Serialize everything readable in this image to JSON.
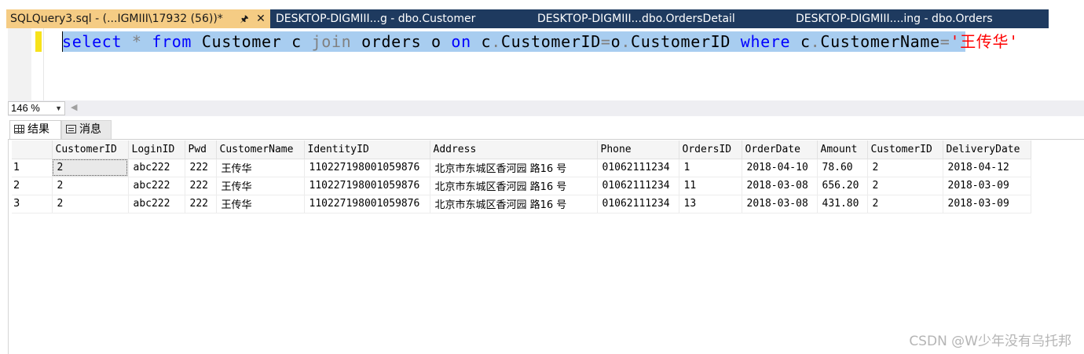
{
  "tabs": [
    {
      "label": "SQLQuery3.sql - (...IGMIII\\17932 (56))*",
      "active": true
    },
    {
      "label": "DESKTOP-DIGMIII...g - dbo.Customer",
      "active": false
    },
    {
      "label": "DESKTOP-DIGMIII...dbo.OrdersDetail",
      "active": false
    },
    {
      "label": "DESKTOP-DIGMIII....ing - dbo.Orders",
      "active": false
    }
  ],
  "tab_icons": {
    "pin": "pin-icon",
    "close": "close-icon"
  },
  "editor": {
    "tokens": [
      {
        "text": "select",
        "kind": "keyword"
      },
      {
        "text": " ",
        "kind": "plain"
      },
      {
        "text": "*",
        "kind": "operator"
      },
      {
        "text": " ",
        "kind": "plain"
      },
      {
        "text": "from",
        "kind": "keyword"
      },
      {
        "text": " Customer c ",
        "kind": "plain"
      },
      {
        "text": "join",
        "kind": "operator"
      },
      {
        "text": " orders o ",
        "kind": "plain"
      },
      {
        "text": "on",
        "kind": "keyword"
      },
      {
        "text": " c",
        "kind": "plain"
      },
      {
        "text": ".",
        "kind": "operator"
      },
      {
        "text": "CustomerID",
        "kind": "plain"
      },
      {
        "text": "=",
        "kind": "operator"
      },
      {
        "text": "o",
        "kind": "plain"
      },
      {
        "text": ".",
        "kind": "operator"
      },
      {
        "text": "CustomerID ",
        "kind": "plain"
      },
      {
        "text": "where",
        "kind": "keyword"
      },
      {
        "text": " c",
        "kind": "plain"
      },
      {
        "text": ".",
        "kind": "operator"
      },
      {
        "text": "CustomerName",
        "kind": "plain"
      },
      {
        "text": "=",
        "kind": "operator"
      },
      {
        "text": "'王传华'",
        "kind": "string"
      }
    ],
    "selected": true
  },
  "zoom": {
    "value": "146 %"
  },
  "result_tabs": {
    "results": "结果",
    "messages": "消息"
  },
  "grid": {
    "columns": [
      "CustomerID",
      "LoginID",
      "Pwd",
      "CustomerName",
      "IdentityID",
      "Address",
      "Phone",
      "OrdersID",
      "OrderDate",
      "Amount",
      "CustomerID",
      "DeliveryDate"
    ],
    "rows": [
      {
        "num": "1",
        "cells": [
          "2",
          "abc222",
          "222",
          "王传华",
          "110227198001059876",
          "北京市东城区香河园 路16 号",
          "01062111234",
          "1",
          "2018-04-10",
          "78.60",
          "2",
          "2018-04-12"
        ]
      },
      {
        "num": "2",
        "cells": [
          "2",
          "abc222",
          "222",
          "王传华",
          "110227198001059876",
          "北京市东城区香河园 路16 号",
          "01062111234",
          "11",
          "2018-03-08",
          "656.20",
          "2",
          "2018-03-09"
        ]
      },
      {
        "num": "3",
        "cells": [
          "2",
          "abc222",
          "222",
          "王传华",
          "110227198001059876",
          "北京市东城区香河园 路16 号",
          "01062111234",
          "13",
          "2018-03-08",
          "431.80",
          "2",
          "2018-03-09"
        ]
      }
    ],
    "selected_cell": {
      "row": 0,
      "col": 0
    }
  },
  "watermark": "CSDN @W少年没有乌托邦",
  "colors": {
    "active_tab": "#f5cc84",
    "tab_bar": "#1e3a5f",
    "keyword": "#0000ff",
    "operator": "#808080",
    "string": "#ff0000",
    "selection": "#a8cdf0",
    "change_marker": "#f7e21a"
  }
}
